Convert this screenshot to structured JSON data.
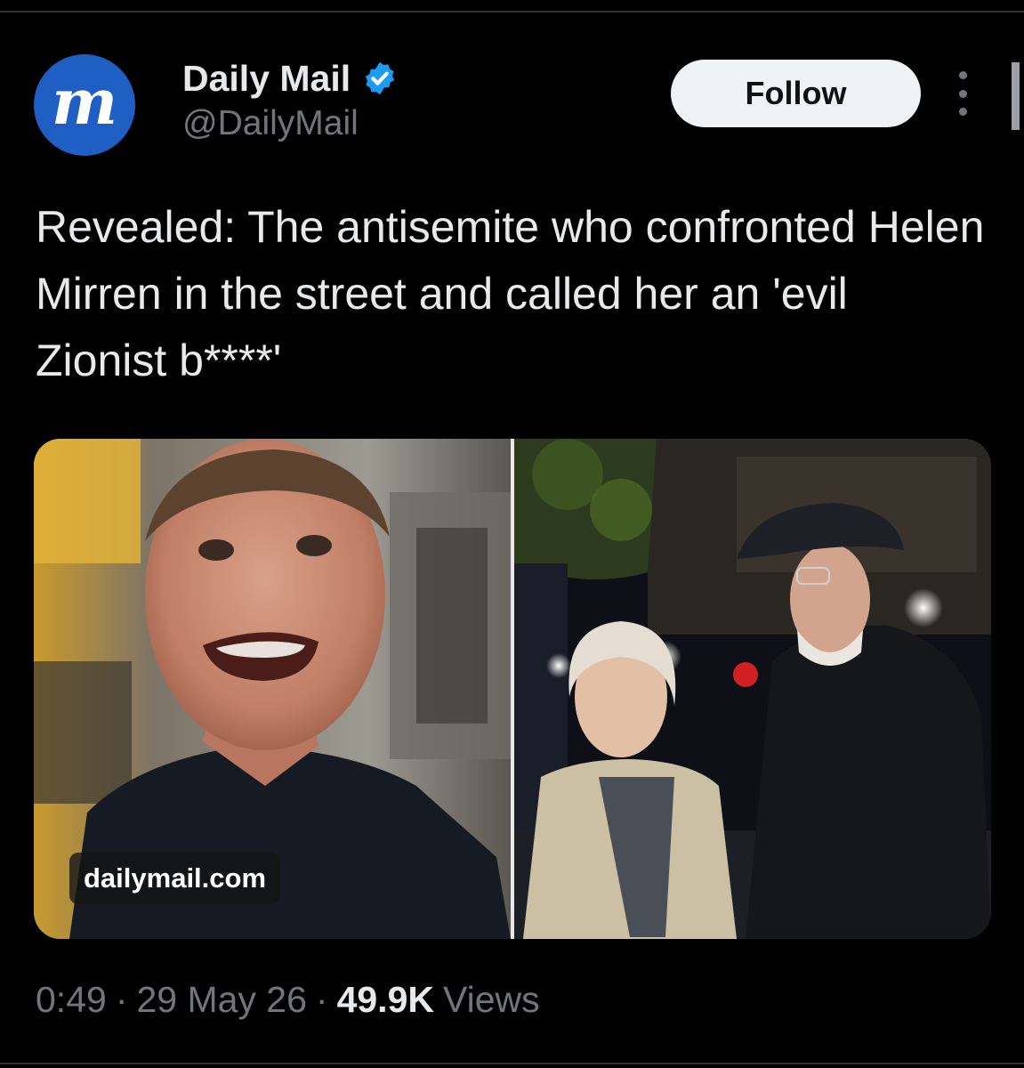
{
  "author": {
    "display_name": "Daily Mail",
    "handle": "@DailyMail",
    "avatar_letter": "m",
    "avatar_color": "#1f5fc4",
    "verified": true,
    "verified_color": "#1d9bf0"
  },
  "actions": {
    "follow_label": "Follow",
    "more_icon": "more-vertical-icon"
  },
  "tweet": {
    "text": "Revealed: The antisemite who confronted Helen Mirren in the street and called her an 'evil Zionist b****'"
  },
  "media": {
    "link_label": "dailymail.com",
    "images": [
      "man-photo",
      "helen-mirren-photo"
    ]
  },
  "meta": {
    "time": "0:49",
    "date": "29 May 26",
    "separator": "·",
    "views_count": "49.9K",
    "views_label": "Views"
  },
  "colors": {
    "background": "#000000",
    "text": "#e7e9ea",
    "muted": "#71767b",
    "follow_button_bg": "#eff3f4"
  }
}
